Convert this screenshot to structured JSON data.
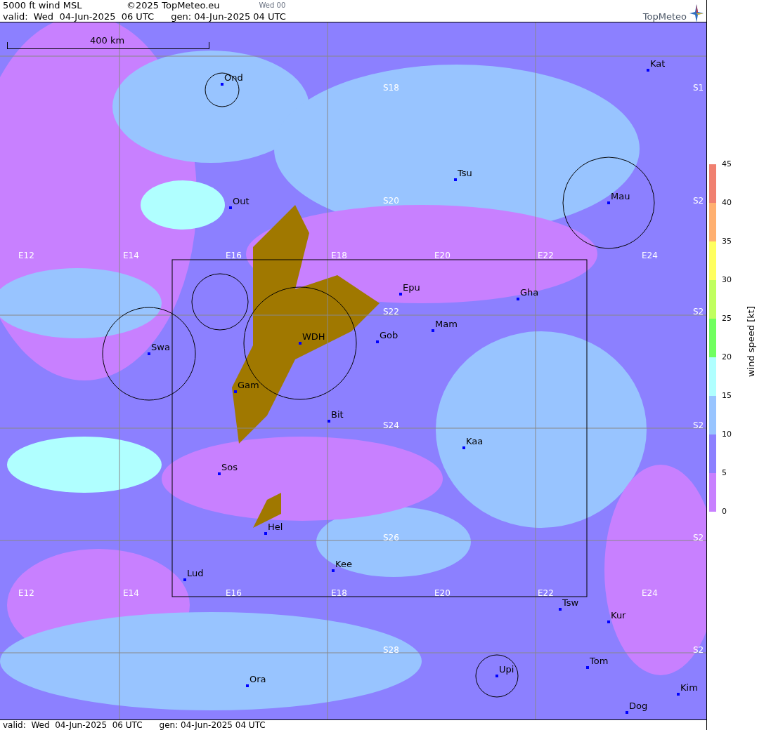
{
  "header": {
    "title": "5000 ft wind MSL",
    "copyright": "©2025 TopMeteo.eu",
    "run": "Wed 00",
    "valid": "valid:  Wed  04-Jun-2025  06 UTC",
    "generated": "gen: 04-Jun-2025 04 UTC",
    "logo": "TopMeteo"
  },
  "map": {
    "scale": "400 km",
    "places": [
      "Ond",
      "Kat",
      "Tsu",
      "Mau",
      "Out",
      "Epu",
      "Gha",
      "Mam",
      "WDH",
      "Gob",
      "Swa",
      "Gam",
      "Bit",
      "Kaa",
      "Sos",
      "Hel",
      "Kee",
      "Lud",
      "Tsw",
      "Kur",
      "Tom",
      "Upi",
      "Ora",
      "Kim",
      "Dog"
    ],
    "longitude_labels": [
      "E12",
      "E14",
      "E16",
      "E18",
      "E20",
      "E22",
      "E24",
      "E12",
      "E14",
      "E16",
      "E18",
      "E20",
      "E22",
      "E24"
    ],
    "latitude_labels": [
      "S18",
      "S20",
      "S22",
      "S24",
      "S26",
      "S28",
      "S1",
      "S2",
      "S2",
      "S2",
      "S2",
      "S2"
    ]
  },
  "footer": {
    "valid": "valid:  Wed  04-Jun-2025  06 UTC",
    "generated": "gen: 04-Jun-2025 04 UTC"
  },
  "legend": {
    "title": "wind speed [kt]",
    "bands": [
      {
        "color": "#f08070"
      },
      {
        "color": "#ffb070"
      },
      {
        "color": "#ffff60"
      },
      {
        "color": "#c0ff60"
      },
      {
        "color": "#70ff60"
      },
      {
        "color": "#b0ffff"
      },
      {
        "color": "#98c4ff"
      },
      {
        "color": "#8c80ff"
      },
      {
        "color": "#c880ff"
      }
    ],
    "ticks": [
      "45",
      "40",
      "35",
      "30",
      "25",
      "20",
      "15",
      "10",
      "5",
      "0"
    ]
  }
}
